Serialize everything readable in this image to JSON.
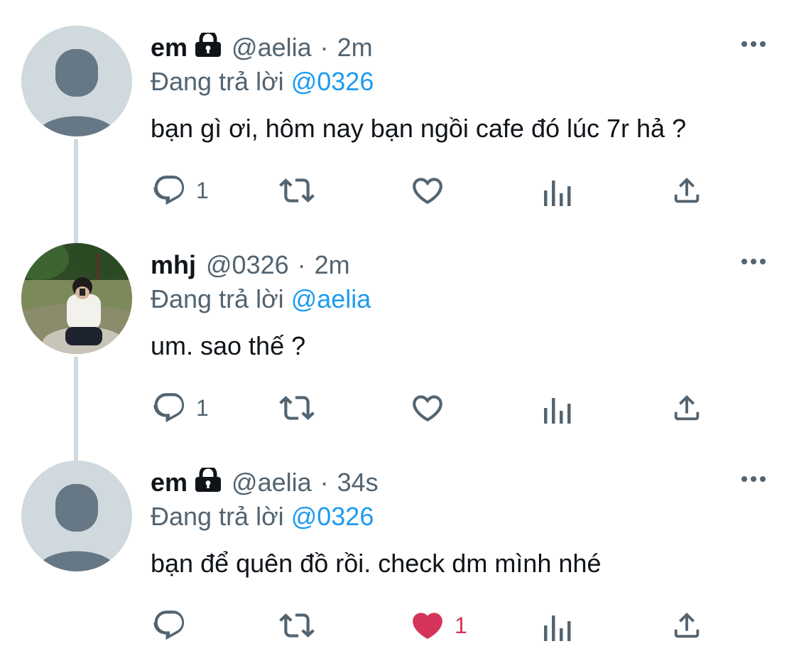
{
  "colors": {
    "text": "#0f1419",
    "muted": "#536471",
    "mention": "#1d9bf0",
    "like": "#f91880",
    "thread_line": "#cfd9de"
  },
  "tweets": [
    {
      "name": "em",
      "handle": "@aelia",
      "sep": "·",
      "time": "2m",
      "reply_prefix": "Đang trả lời",
      "reply_to": "@0326",
      "text": "bạn gì ơi, hôm nay bạn ngồi cafe đó lúc 7r hả ?",
      "reply_count": "1",
      "like_count": "",
      "liked": false,
      "protected": true,
      "avatar": "default-avatar"
    },
    {
      "name": "mhj",
      "handle": "@0326",
      "sep": "·",
      "time": "2m",
      "reply_prefix": "Đang trả lời",
      "reply_to": "@aelia",
      "text": "um. sao thế ?",
      "reply_count": "1",
      "like_count": "",
      "liked": false,
      "protected": false,
      "avatar": "photo-avatar"
    },
    {
      "name": "em",
      "handle": "@aelia",
      "sep": "·",
      "time": "34s",
      "reply_prefix": "Đang trả lời",
      "reply_to": "@0326",
      "text": "bạn để quên đồ rồi. check dm mình nhé",
      "reply_count": "",
      "like_count": "1",
      "liked": true,
      "protected": true,
      "avatar": "default-avatar"
    }
  ],
  "icons": [
    "lock-icon",
    "more-icon",
    "reply-icon",
    "retweet-icon",
    "like-icon",
    "views-icon",
    "share-icon"
  ]
}
